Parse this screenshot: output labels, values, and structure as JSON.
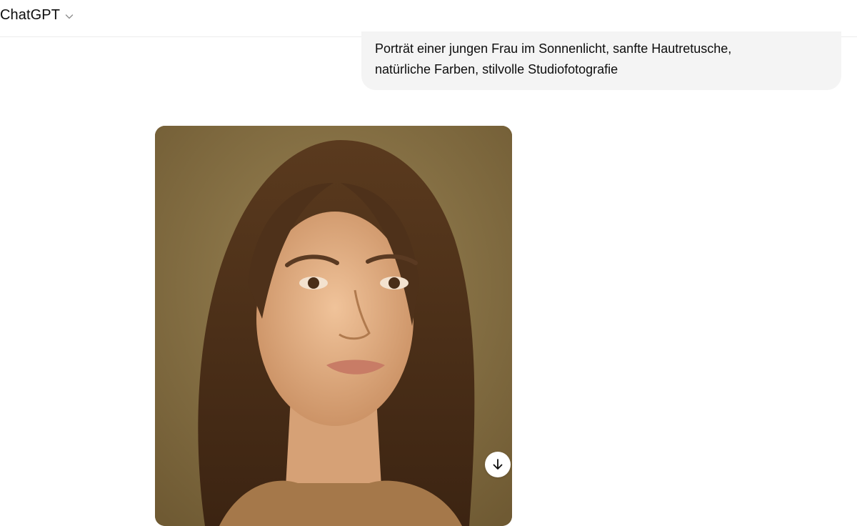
{
  "header": {
    "model_label": "ChatGPT",
    "model_dropdown_icon": "chevron-down-icon"
  },
  "conversation": {
    "user_message": {
      "lines": [
        "Porträt einer jungen Frau im Sonnenlicht, sanfte Hautretusche,",
        "natürliche Farben, stilvolle Studiofotografie"
      ]
    },
    "assistant_image": {
      "download_icon": "arrow-down-icon"
    }
  },
  "colors": {
    "bubble_background": "#f4f4f4",
    "image_background": "#8a7448"
  }
}
